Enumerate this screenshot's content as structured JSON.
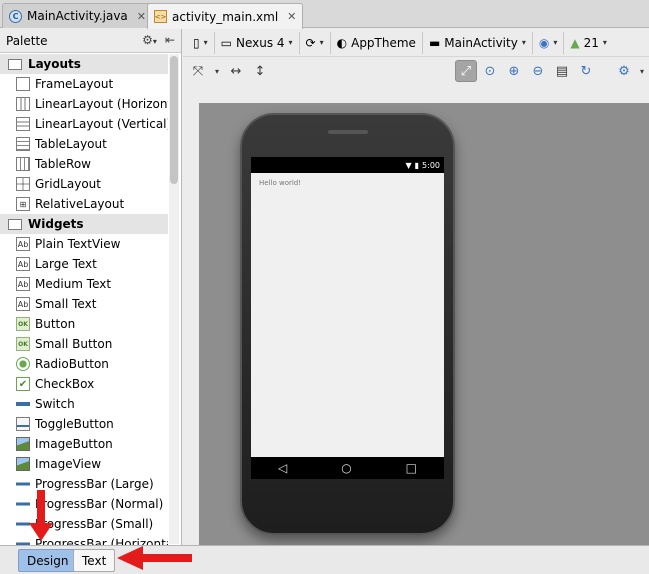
{
  "editor_tabs": [
    {
      "label": "MainActivity.java",
      "icon": "class-file-icon",
      "badge": "C",
      "active": false
    },
    {
      "label": "activity_main.xml",
      "icon": "xml-file-icon",
      "badge": "<>",
      "active": true
    }
  ],
  "palette": {
    "title": "Palette",
    "categories": [
      {
        "label": "Layouts",
        "items": [
          "FrameLayout",
          "LinearLayout (Horizontal)",
          "LinearLayout (Vertical)",
          "TableLayout",
          "TableRow",
          "GridLayout",
          "RelativeLayout"
        ]
      },
      {
        "label": "Widgets",
        "items": [
          "Plain TextView",
          "Large Text",
          "Medium Text",
          "Small Text",
          "Button",
          "Small Button",
          "RadioButton",
          "CheckBox",
          "Switch",
          "ToggleButton",
          "ImageButton",
          "ImageView",
          "ProgressBar (Large)",
          "ProgressBar (Normal)",
          "ProgressBar (Small)",
          "ProgressBar (Horizontal)"
        ]
      }
    ],
    "item_badges": {
      "text": "Ab",
      "button": "OK"
    }
  },
  "toolbar": {
    "device": "Nexus 4",
    "theme": "AppTheme",
    "activity": "MainActivity",
    "api_level": "21"
  },
  "preview": {
    "time": "5:00",
    "hello_text": "Hello world!"
  },
  "bottom_tabs": {
    "design": "Design",
    "text": "Text"
  },
  "colors": {
    "annotation_arrow": "#e31b1b",
    "active_tab": "#9fc0e8",
    "canvas": "#8e8e8e"
  }
}
